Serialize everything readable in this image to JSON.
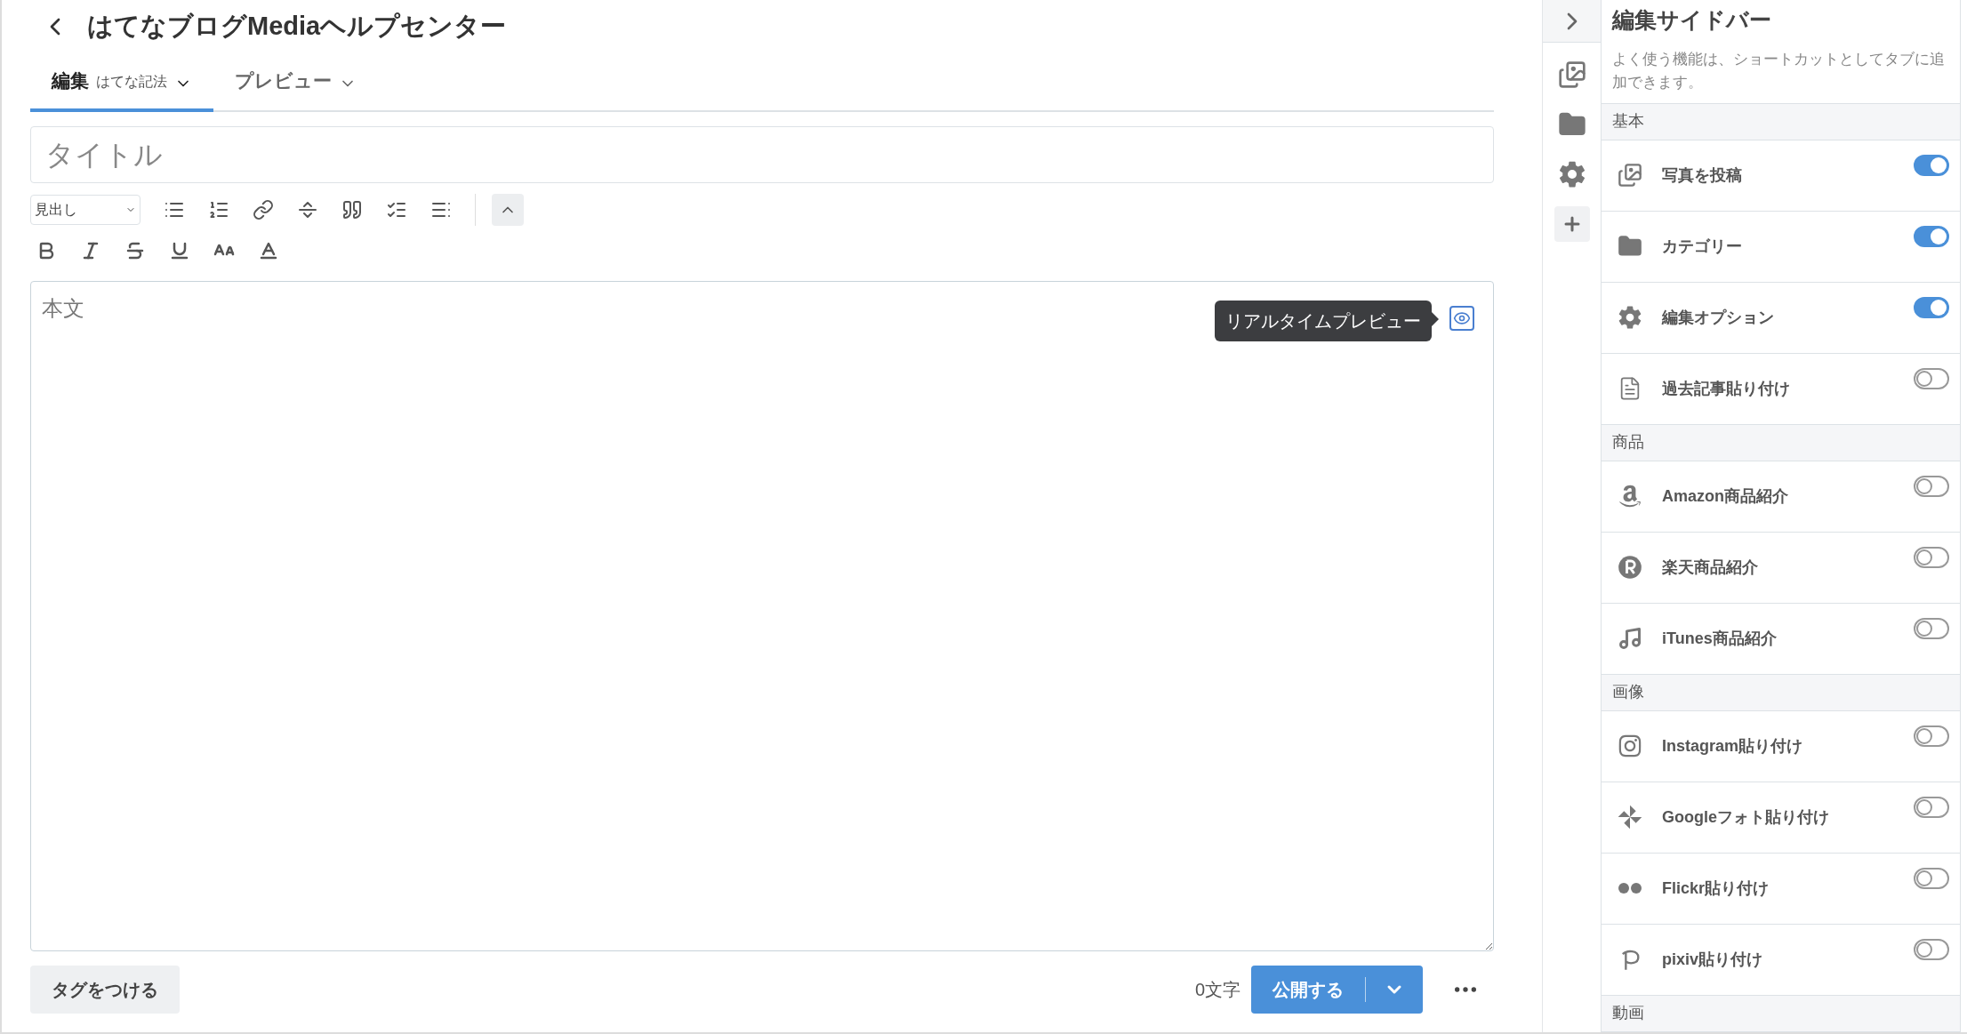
{
  "header": {
    "title": "はてなブログMediaヘルプセンター"
  },
  "tabs": [
    {
      "label": "編集",
      "sublabel": "はてな記法",
      "selected": true
    },
    {
      "label": "プレビュー",
      "selected": false
    }
  ],
  "title_field": {
    "placeholder": "タイトル"
  },
  "heading_select": {
    "value": "見出し"
  },
  "body_field": {
    "placeholder": "本文"
  },
  "tooltip": {
    "text": "リアルタイムプレビュー"
  },
  "footer": {
    "tag_button": "タグをつける",
    "char_count": "0文字",
    "publish_button": "公開する"
  },
  "sidebar": {
    "title": "編集サイドバー",
    "description": "よく使う機能は、ショートカットとしてタブに追加できます。",
    "sections": [
      {
        "title": "基本",
        "items": [
          {
            "label": "写真を投稿",
            "on": true
          },
          {
            "label": "カテゴリー",
            "on": true
          },
          {
            "label": "編集オプション",
            "on": true
          },
          {
            "label": "過去記事貼り付け",
            "on": false
          }
        ]
      },
      {
        "title": "商品",
        "items": [
          {
            "label": "Amazon商品紹介",
            "on": false
          },
          {
            "label": "楽天商品紹介",
            "on": false
          },
          {
            "label": "iTunes商品紹介",
            "on": false
          }
        ]
      },
      {
        "title": "画像",
        "items": [
          {
            "label": "Instagram貼り付け",
            "on": false
          },
          {
            "label": "Googleフォト貼り付け",
            "on": false
          },
          {
            "label": "Flickr貼り付け",
            "on": false
          },
          {
            "label": "pixiv貼り付け",
            "on": false
          }
        ]
      },
      {
        "title": "動画"
      }
    ]
  }
}
